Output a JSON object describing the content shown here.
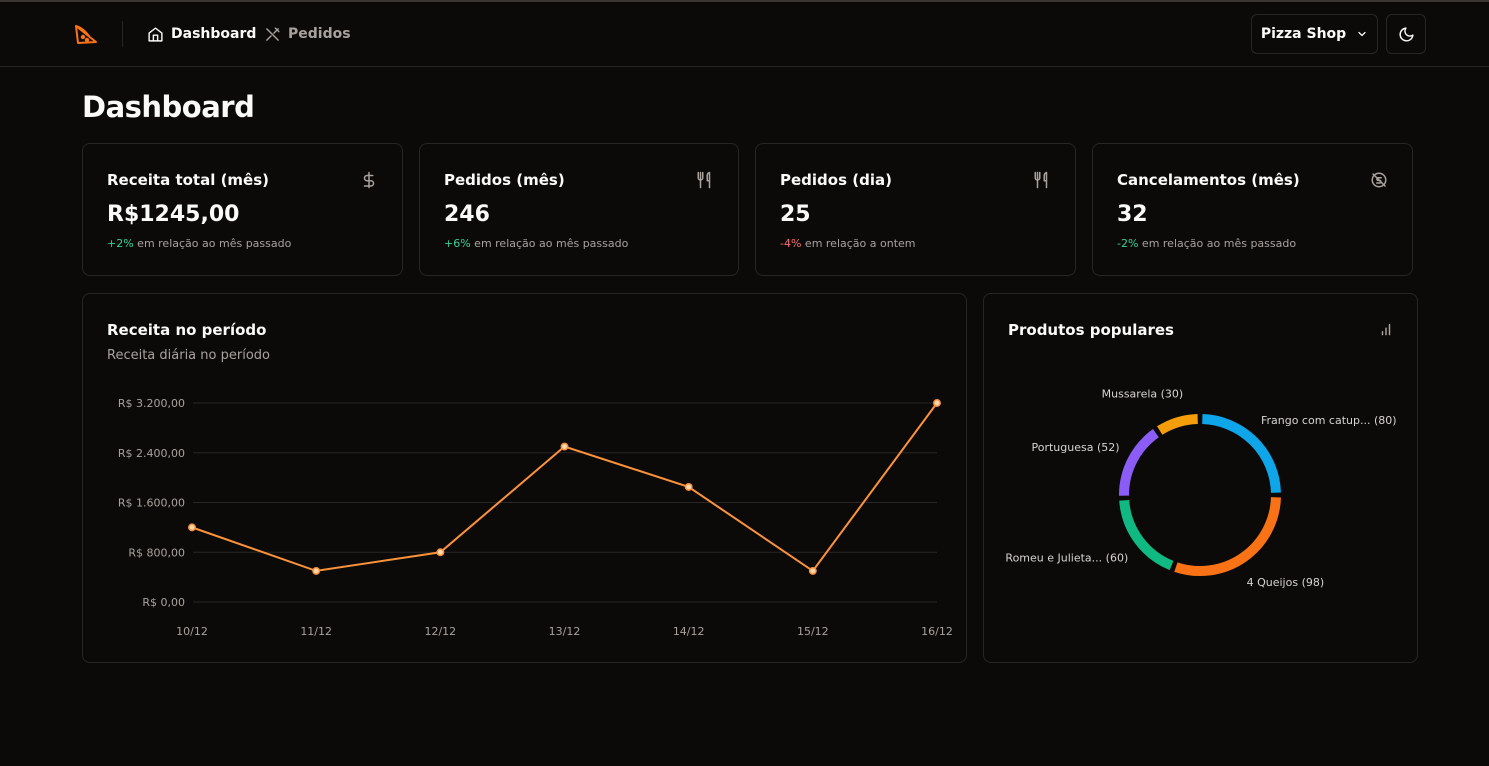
{
  "header": {
    "nav": [
      {
        "label": "Dashboard",
        "icon": "home-icon",
        "active": true
      },
      {
        "label": "Pedidos",
        "icon": "utensils-crossed-icon",
        "active": false
      }
    ],
    "store_label": "Pizza Shop",
    "accent": "#f97316"
  },
  "page": {
    "title": "Dashboard"
  },
  "stats": [
    {
      "title": "Receita total (mês)",
      "icon": "dollar-sign-icon",
      "value": "R$1245,00",
      "delta": "+2%",
      "delta_type": "pos",
      "foot": "em relação ao mês passado"
    },
    {
      "title": "Pedidos (mês)",
      "icon": "utensils-icon",
      "value": "246",
      "delta": "+6%",
      "delta_type": "pos",
      "foot": "em relação ao mês passado"
    },
    {
      "title": "Pedidos (dia)",
      "icon": "utensils-icon",
      "value": "25",
      "delta": "-4%",
      "delta_type": "neg",
      "foot": "em relação a ontem"
    },
    {
      "title": "Cancelamentos (mês)",
      "icon": "dollar-off-icon",
      "value": "32",
      "delta": "-2%",
      "delta_type": "pos",
      "foot": "em relação ao mês passado"
    }
  ],
  "revenue_card": {
    "title": "Receita no período",
    "subtitle": "Receita diária no período"
  },
  "popular_card": {
    "title": "Produtos populares",
    "icon": "bar-chart-icon"
  },
  "chart_data": [
    {
      "type": "line",
      "x": [
        "10/12",
        "11/12",
        "12/12",
        "13/12",
        "14/12",
        "15/12",
        "16/12"
      ],
      "series": [
        {
          "values": [
            1200,
            500,
            800,
            2500,
            1850,
            500,
            3200
          ],
          "color": "#fb923c"
        }
      ],
      "yticks": [
        "R$ 0,00",
        "R$ 800,00",
        "R$ 1.600,00",
        "R$ 2.400,00",
        "R$ 3.200,00"
      ],
      "ytick_values": [
        0,
        800,
        1600,
        2400,
        3200
      ],
      "ylim": [
        0,
        3200
      ],
      "grid": true
    },
    {
      "type": "pie",
      "donut": true,
      "slices": [
        {
          "label": "Frango com catup... (80)",
          "value": 80,
          "color": "#0ea5e9"
        },
        {
          "label": "4 Queijos (98)",
          "value": 98,
          "color": "#f97316"
        },
        {
          "label": "Romeu e Julieta... (60)",
          "value": 60,
          "color": "#10b981"
        },
        {
          "label": "Portuguesa (52)",
          "value": 52,
          "color": "#8b5cf6"
        },
        {
          "label": "Mussarela (30)",
          "value": 30,
          "color": "#f59e0b"
        }
      ]
    }
  ]
}
